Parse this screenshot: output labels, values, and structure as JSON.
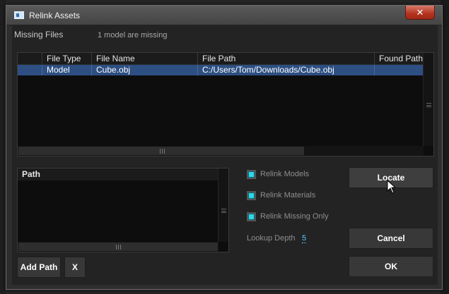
{
  "window": {
    "title": "Relink Assets",
    "close_glyph": "✕"
  },
  "missing": {
    "label": "Missing Files",
    "count_text": "1 model are missing"
  },
  "table": {
    "columns": [
      "File Type",
      "File Name",
      "File Path",
      "Found Path"
    ],
    "rows": [
      [
        "Model",
        "Cube.obj",
        "C:/Users/Tom/Downloads/Cube.obj",
        ""
      ]
    ]
  },
  "paths": {
    "header": "Path"
  },
  "options": {
    "relink_models": {
      "label": "Relink Models",
      "checked": true
    },
    "relink_materials": {
      "label": "Relink Materials",
      "checked": true
    },
    "relink_missing_only": {
      "label": "Relink Missing Only",
      "checked": true
    },
    "lookup_depth_label": "Lookup Depth",
    "lookup_depth_value": "5"
  },
  "buttons": {
    "locate": "Locate",
    "cancel": "Cancel",
    "ok": "OK",
    "add_path": "Add Path",
    "remove_path": "X"
  },
  "colors": {
    "selection": "#2d4f82",
    "checkbox": "#2fd6e8",
    "close_button": "#b3341f"
  }
}
